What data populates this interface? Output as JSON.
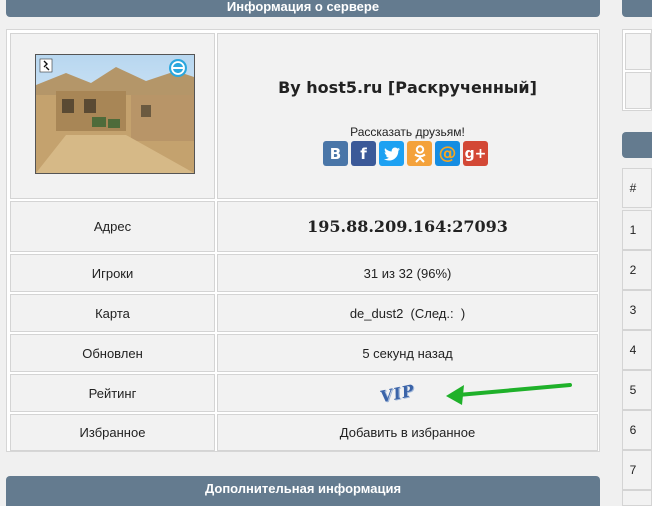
{
  "panel": {
    "title": "Информация о сервере",
    "additional_title": "Дополнительная информация"
  },
  "server": {
    "name": "By host5.ru [Раскрученный]",
    "share_text": "Рассказать друзьям!",
    "share_icons": [
      {
        "name": "vk-icon",
        "glyph": "B",
        "color": "#4a76a8"
      },
      {
        "name": "facebook-icon",
        "glyph": "f",
        "color": "#3b5998"
      },
      {
        "name": "twitter-icon",
        "glyph": "t",
        "color": "#1da1f2"
      },
      {
        "name": "odnoklassniki-icon",
        "glyph": "ok",
        "color": "#f4a23b"
      },
      {
        "name": "mailru-icon",
        "glyph": "@",
        "color": "#168de2"
      },
      {
        "name": "googleplus-icon",
        "glyph": "g+",
        "color": "#d34836"
      }
    ]
  },
  "rows": {
    "address_label": "Адрес",
    "address_value": "195.88.209.164:27093",
    "players_label": "Игроки",
    "players_value": "31 из 32 (96%)",
    "map_label": "Карта",
    "map_value": "de_dust2  (След.:  )",
    "updated_label": "Обновлен",
    "updated_value": "5 секунд назад",
    "rating_label": "Рейтинг",
    "rating_value": "VIP",
    "favorite_label": "Избранное",
    "favorite_value": "Добавить в избранное"
  },
  "side": {
    "header": "#",
    "numbers": [
      "1",
      "2",
      "3",
      "4",
      "5",
      "6",
      "7"
    ]
  },
  "colors": {
    "header_bg": "#647b8f",
    "arrow": "#1fb12a"
  }
}
